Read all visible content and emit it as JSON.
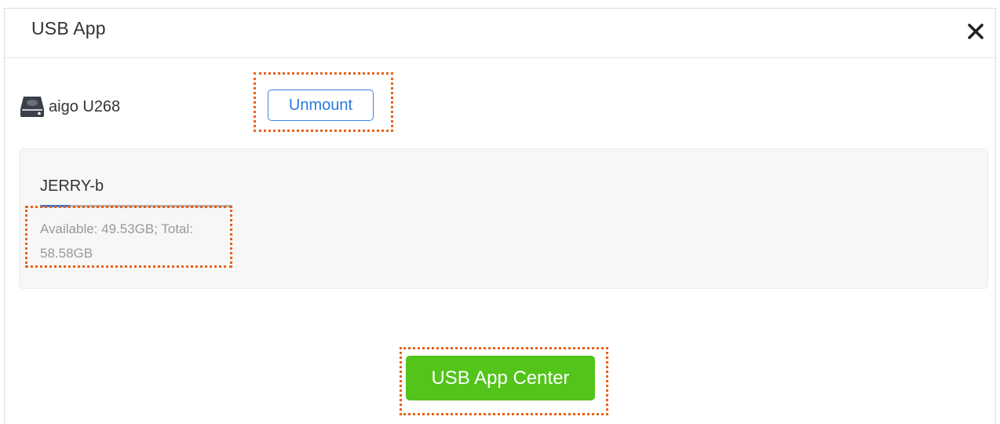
{
  "dialog": {
    "title": "USB App",
    "close_icon": "close-icon"
  },
  "device": {
    "icon": "usb-drive-icon",
    "name": "aigo U268",
    "unmount_label": "Unmount"
  },
  "partition": {
    "name": "JERRY-b",
    "capacity_text": "Available: 49.53GB; Total: 58.58GB",
    "used_fraction": 0.154,
    "usage_color": "#2a7bdc"
  },
  "footer": {
    "app_center_label": "USB App Center",
    "button_color": "#52c41a"
  },
  "annotations": {
    "highlight_color": "#e8621a"
  }
}
